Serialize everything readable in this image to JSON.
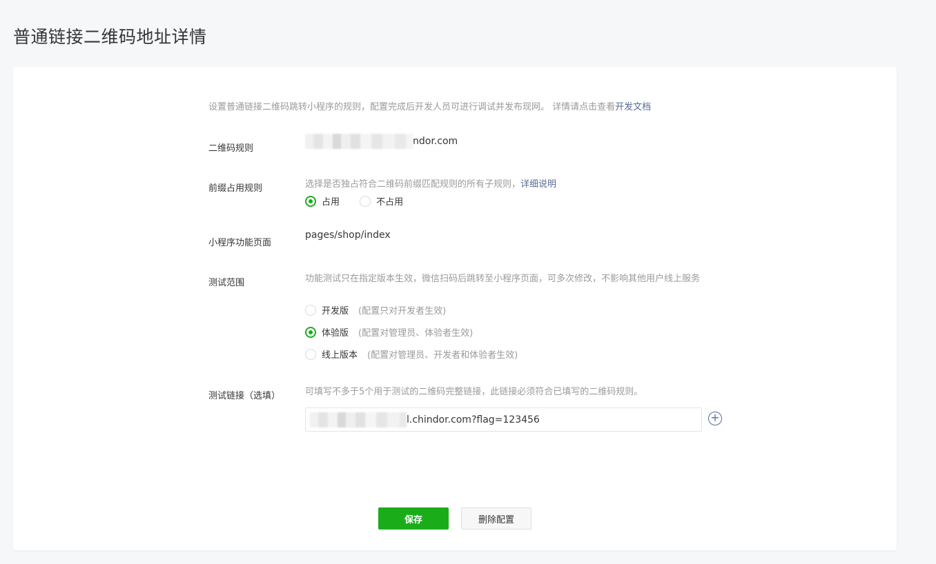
{
  "page": {
    "title": "普通链接二维码地址详情"
  },
  "intro": {
    "text": "设置普通链接二维码跳转小程序的规则，配置完成后开发人员可进行调试并发布现网。 详情请点击查看",
    "link_label": "开发文档"
  },
  "rules": {
    "qr_rule_label": "二维码规则",
    "qr_rule_value_suffix": "ndor.com",
    "prefix_label": "前缀占用规则",
    "prefix_hint": "选择是否独占符合二维码前缀匹配规则的所有子规则，",
    "prefix_hint_link": "详细说明",
    "prefix_options": [
      {
        "label": "占用",
        "checked": true
      },
      {
        "label": "不占用",
        "checked": false
      }
    ],
    "page_label": "小程序功能页面",
    "page_value": "pages/shop/index",
    "scope_label": "测试范围",
    "scope_hint": "功能测试只在指定版本生效，微信扫码后跳转至小程序页面，可多次修改，不影响其他用户线上服务",
    "scope_options": [
      {
        "label": "开发版",
        "note": "(配置只对开发者生效)",
        "checked": false
      },
      {
        "label": "体验版",
        "note": "(配置对管理员、体验者生效)",
        "checked": true
      },
      {
        "label": "线上版本",
        "note": "(配置对管理员、开发者和体验者生效)",
        "checked": false
      }
    ],
    "test_link_label": "测试链接（选填）",
    "test_link_hint": "可填写不多于5个用于测试的二维码完整链接，此链接必须符合已填写的二维码规则。",
    "test_link_value_suffix": "l.chindor.com?flag=123456",
    "add_icon": "plus-circle-icon"
  },
  "actions": {
    "save_label": "保存",
    "delete_label": "删除配置"
  },
  "colors": {
    "primary": "#1aad19",
    "link": "#576b95",
    "muted": "#9a9a9a",
    "background": "#f6f7f9"
  }
}
